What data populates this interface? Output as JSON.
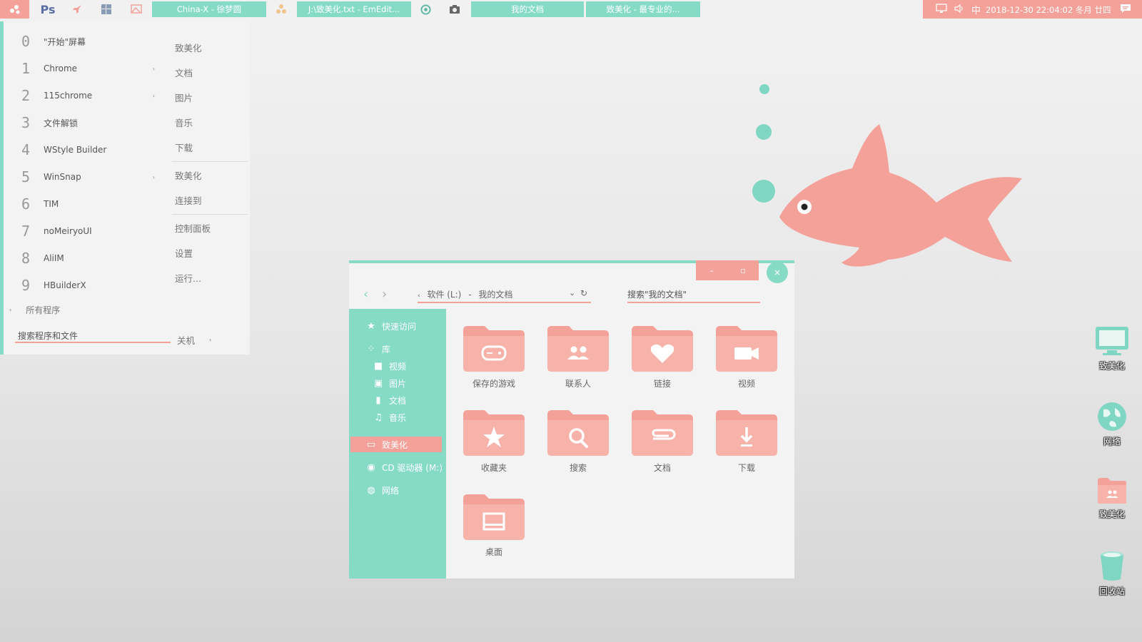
{
  "colors": {
    "accent_teal": "#86dbc7",
    "accent_pink": "#f4a199",
    "background": "#eeeeee"
  },
  "taskbar": {
    "start_icon": "flower-icon",
    "icons": [
      "photoshop-icon",
      "rocket-icon",
      "windows-icon",
      "image-icon",
      "radiation-icon",
      "chrome-icon",
      "camera-icon"
    ],
    "ps_label": "Ps",
    "tasks": [
      "China-X - 徐梦圆",
      "J:\\致美化.txt - EmEdit...",
      "我的文档",
      "致美化 - 最专业的..."
    ],
    "tray": {
      "input_method": "中",
      "datetime": "2018-12-30  22:04:02  冬月 廿四"
    }
  },
  "start_menu": {
    "items": [
      {
        "num": "0",
        "label": "\"开始\"屏幕",
        "arrow": ""
      },
      {
        "num": "1",
        "label": "Chrome",
        "arrow": "›"
      },
      {
        "num": "2",
        "label": "115chrome",
        "arrow": "›"
      },
      {
        "num": "3",
        "label": "文件解锁",
        "arrow": ""
      },
      {
        "num": "4",
        "label": "WStyle Builder",
        "arrow": ""
      },
      {
        "num": "5",
        "label": "WinSnap",
        "arrow": "›"
      },
      {
        "num": "6",
        "label": "TIM",
        "arrow": ""
      },
      {
        "num": "7",
        "label": "noMeiryoUI",
        "arrow": ""
      },
      {
        "num": "8",
        "label": "AliIM",
        "arrow": ""
      },
      {
        "num": "9",
        "label": "HBuilderX",
        "arrow": ""
      }
    ],
    "all_programs": "所有程序",
    "search_placeholder": "搜索程序和文件",
    "right_items": [
      "致美化",
      "文档",
      "图片",
      "音乐",
      "下载",
      "致美化",
      "连接到",
      "控制面板",
      "设置",
      "运行..."
    ],
    "shutdown": "关机"
  },
  "explorer": {
    "address": {
      "drive": "软件 (L:)",
      "sep": "-",
      "folder": "我的文档"
    },
    "search_placeholder": "搜索\"我的文档\"",
    "controls": {
      "minimize": "–",
      "maximize": "▫",
      "close": "×"
    },
    "nav": {
      "quick_access": "快速访问",
      "library": "库",
      "videos": "视频",
      "pictures": "图片",
      "documents": "文档",
      "music": "音乐",
      "this_pc": "致美化",
      "cd_drive": "CD 驱动器 (M:)",
      "network": "网络"
    },
    "folders": [
      {
        "label": "保存的游戏",
        "icon": "gamepad-icon"
      },
      {
        "label": "联系人",
        "icon": "contacts-icon"
      },
      {
        "label": "链接",
        "icon": "heart-icon"
      },
      {
        "label": "视频",
        "icon": "video-camera-icon"
      },
      {
        "label": "收藏夹",
        "icon": "star-icon"
      },
      {
        "label": "搜索",
        "icon": "magnifier-icon"
      },
      {
        "label": "文档",
        "icon": "paperclip-icon"
      },
      {
        "label": "下载",
        "icon": "download-icon"
      },
      {
        "label": "桌面",
        "icon": "desktop-icon"
      }
    ]
  },
  "desktop_icons": [
    {
      "label": "致美化",
      "icon": "monitor-icon"
    },
    {
      "label": "网络",
      "icon": "globe-icon"
    },
    {
      "label": "致美化",
      "icon": "user-folder-icon"
    },
    {
      "label": "回收站",
      "icon": "recycle-bin-icon"
    }
  ]
}
